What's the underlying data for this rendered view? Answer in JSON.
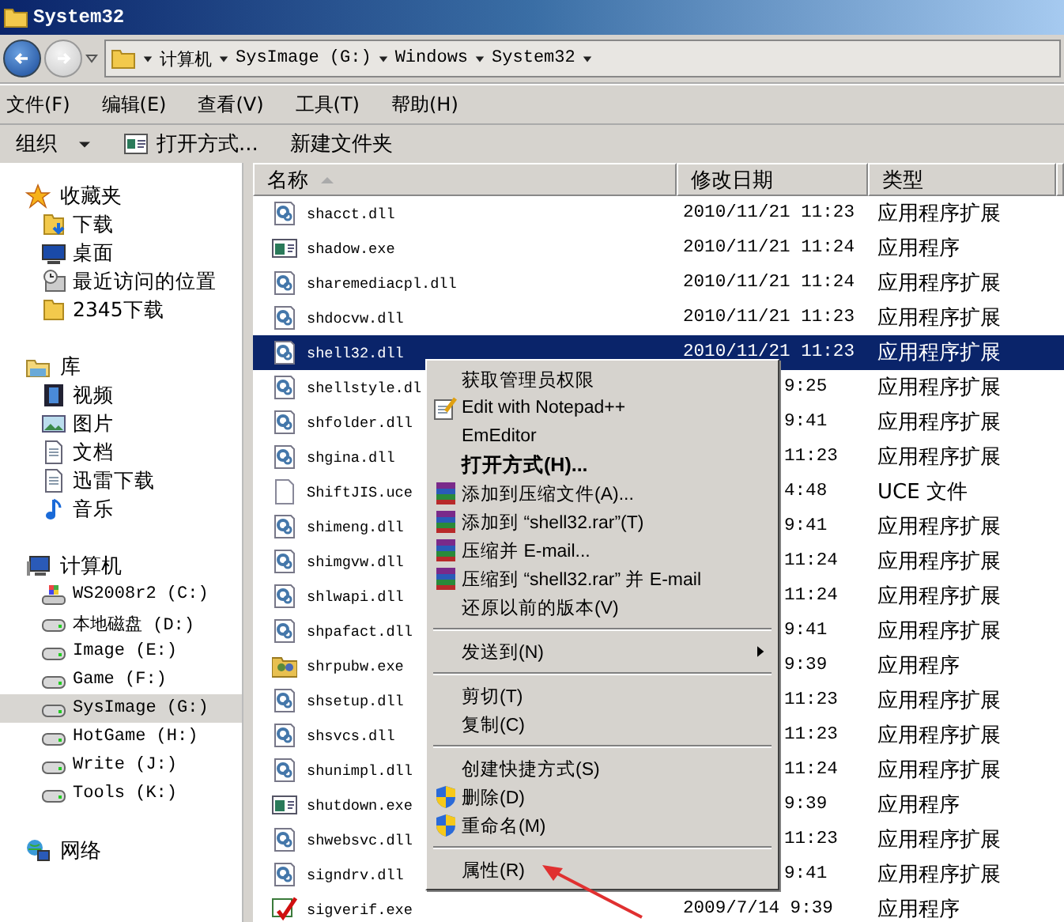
{
  "window": {
    "title": "System32"
  },
  "navigation": {
    "back": {
      "disabled": false
    },
    "forward": {
      "disabled": true
    }
  },
  "address": {
    "segments": [
      "计算机",
      "SysImage (G:)",
      "Windows",
      "System32"
    ]
  },
  "menu_bar": [
    "文件(F)",
    "编辑(E)",
    "查看(V)",
    "工具(T)",
    "帮助(H)"
  ],
  "toolbar": [
    {
      "label": "组织",
      "kind": "dropdown"
    },
    {
      "label": "打开方式...",
      "kind": "open"
    },
    {
      "label": "新建文件夹",
      "kind": "plain"
    }
  ],
  "sidebar": {
    "sections": [
      {
        "label": "收藏夹",
        "kind": "star",
        "items": [
          {
            "label": "下载",
            "kind": "download",
            "selected": false
          },
          {
            "label": "桌面",
            "kind": "monitor",
            "selected": false
          },
          {
            "label": "最近访问的位置",
            "kind": "recent",
            "selected": false
          },
          {
            "label": "2345下载",
            "kind": "folder",
            "selected": false
          }
        ]
      },
      {
        "label": "库",
        "kind": "library",
        "items": [
          {
            "label": "视频",
            "kind": "film",
            "selected": false
          },
          {
            "label": "图片",
            "kind": "image",
            "selected": false
          },
          {
            "label": "文档",
            "kind": "document",
            "selected": false
          },
          {
            "label": "迅雷下载",
            "kind": "document",
            "selected": false
          },
          {
            "label": "音乐",
            "kind": "music",
            "selected": false
          }
        ]
      },
      {
        "label": "计算机",
        "kind": "computer",
        "items": [
          {
            "label": "WS2008r2 (C:)",
            "kind": "windrive",
            "selected": false
          },
          {
            "label": "本地磁盘 (D:)",
            "kind": "drive",
            "selected": false
          },
          {
            "label": "Image (E:)",
            "kind": "drive",
            "selected": false
          },
          {
            "label": "Game (F:)",
            "kind": "drive",
            "selected": false
          },
          {
            "label": "SysImage (G:)",
            "kind": "drive",
            "selected": true
          },
          {
            "label": "HotGame (H:)",
            "kind": "drive",
            "selected": false
          },
          {
            "label": "Write (J:)",
            "kind": "drive",
            "selected": false
          },
          {
            "label": "Tools (K:)",
            "kind": "drive",
            "selected": false
          }
        ]
      },
      {
        "label": "网络",
        "kind": "network"
      }
    ]
  },
  "table": {
    "columns": [
      {
        "label": "名称",
        "sorted": true
      },
      {
        "label": "修改日期",
        "sorted": false
      },
      {
        "label": "类型",
        "sorted": false
      }
    ],
    "rows": [
      {
        "name": "shacct.dll",
        "kind": "dll",
        "date": "2010/11/21 11:23",
        "type": "应用程序扩展",
        "selected": false,
        "partial": false
      },
      {
        "name": "shadow.exe",
        "kind": "exe",
        "date": "2010/11/21 11:24",
        "type": "应用程序",
        "selected": false,
        "partial": false
      },
      {
        "name": "sharemediacpl.dll",
        "kind": "dll",
        "date": "2010/11/21 11:24",
        "type": "应用程序扩展",
        "selected": false,
        "partial": false
      },
      {
        "name": "shdocvw.dll",
        "kind": "dll",
        "date": "2010/11/21 11:23",
        "type": "应用程序扩展",
        "selected": false,
        "partial": false
      },
      {
        "name": "shell32.dll",
        "kind": "dll",
        "date": "2010/11/21 11:23",
        "type": "应用程序扩展",
        "selected": true,
        "partial": false
      },
      {
        "name": "shellstyle.dl",
        "kind": "dll",
        "date": "9:25",
        "type": "应用程序扩展",
        "selected": false,
        "partial": true
      },
      {
        "name": "shfolder.dll",
        "kind": "dll",
        "date": "9:41",
        "type": "应用程序扩展",
        "selected": false,
        "partial": true
      },
      {
        "name": "shgina.dll",
        "kind": "dll",
        "date": "11:23",
        "type": "应用程序扩展",
        "selected": false,
        "partial": true
      },
      {
        "name": "ShiftJIS.uce",
        "kind": "blank",
        "date": "4:48",
        "type": "UCE 文件",
        "selected": false,
        "partial": true
      },
      {
        "name": "shimeng.dll",
        "kind": "dll",
        "date": "9:41",
        "type": "应用程序扩展",
        "selected": false,
        "partial": true
      },
      {
        "name": "shimgvw.dll",
        "kind": "dll",
        "date": "11:24",
        "type": "应用程序扩展",
        "selected": false,
        "partial": true
      },
      {
        "name": "shlwapi.dll",
        "kind": "dll",
        "date": "11:24",
        "type": "应用程序扩展",
        "selected": false,
        "partial": true
      },
      {
        "name": "shpafact.dll",
        "kind": "dll",
        "date": "9:41",
        "type": "应用程序扩展",
        "selected": false,
        "partial": true
      },
      {
        "name": "shrpubw.exe",
        "kind": "people",
        "date": "9:39",
        "type": "应用程序",
        "selected": false,
        "partial": true
      },
      {
        "name": "shsetup.dll",
        "kind": "dll",
        "date": "11:23",
        "type": "应用程序扩展",
        "selected": false,
        "partial": true
      },
      {
        "name": "shsvcs.dll",
        "kind": "dll",
        "date": "11:23",
        "type": "应用程序扩展",
        "selected": false,
        "partial": true
      },
      {
        "name": "shunimpl.dll",
        "kind": "dll",
        "date": "11:24",
        "type": "应用程序扩展",
        "selected": false,
        "partial": true
      },
      {
        "name": "shutdown.exe",
        "kind": "exe",
        "date": "9:39",
        "type": "应用程序",
        "selected": false,
        "partial": true
      },
      {
        "name": "shwebsvc.dll",
        "kind": "dll",
        "date": "11:23",
        "type": "应用程序扩展",
        "selected": false,
        "partial": true
      },
      {
        "name": "signdrv.dll",
        "kind": "dll",
        "date": "9:41",
        "type": "应用程序扩展",
        "selected": false,
        "partial": true
      },
      {
        "name": "sigverif.exe",
        "kind": "check",
        "date": "2009/7/14 9:39",
        "type": "应用程序",
        "selected": false,
        "partial": false
      }
    ]
  },
  "context_menu": {
    "groups": [
      [
        {
          "label": "获取管理员权限",
          "kind": "plain",
          "bold": false,
          "submenu": false
        },
        {
          "label": "Edit with Notepad++",
          "kind": "notepad",
          "bold": false,
          "submenu": false
        },
        {
          "label": "EmEditor",
          "kind": "plain",
          "bold": false,
          "submenu": false
        },
        {
          "label": "打开方式(H)...",
          "kind": "plain",
          "bold": true,
          "submenu": false
        },
        {
          "label": "添加到压缩文件(A)...",
          "kind": "rar",
          "bold": false,
          "submenu": false
        },
        {
          "label": "添加到 “shell32.rar”(T)",
          "kind": "rar",
          "bold": false,
          "submenu": false
        },
        {
          "label": "压缩并 E-mail...",
          "kind": "rar",
          "bold": false,
          "submenu": false
        },
        {
          "label": "压缩到 “shell32.rar” 并 E-mail",
          "kind": "rar",
          "bold": false,
          "submenu": false
        },
        {
          "label": "还原以前的版本(V)",
          "kind": "plain",
          "bold": false,
          "submenu": false
        }
      ],
      [
        {
          "label": "发送到(N)",
          "kind": "plain",
          "bold": false,
          "submenu": true
        }
      ],
      [
        {
          "label": "剪切(T)",
          "kind": "plain",
          "bold": false,
          "submenu": false
        },
        {
          "label": "复制(C)",
          "kind": "plain",
          "bold": false,
          "submenu": false
        }
      ],
      [
        {
          "label": "创建快捷方式(S)",
          "kind": "plain",
          "bold": false,
          "submenu": false
        },
        {
          "label": "删除(D)",
          "kind": "shield",
          "bold": false,
          "submenu": false
        },
        {
          "label": "重命名(M)",
          "kind": "shield",
          "bold": false,
          "submenu": false
        }
      ],
      [
        {
          "label": "属性(R)",
          "kind": "plain",
          "bold": false,
          "submenu": false
        }
      ]
    ]
  }
}
